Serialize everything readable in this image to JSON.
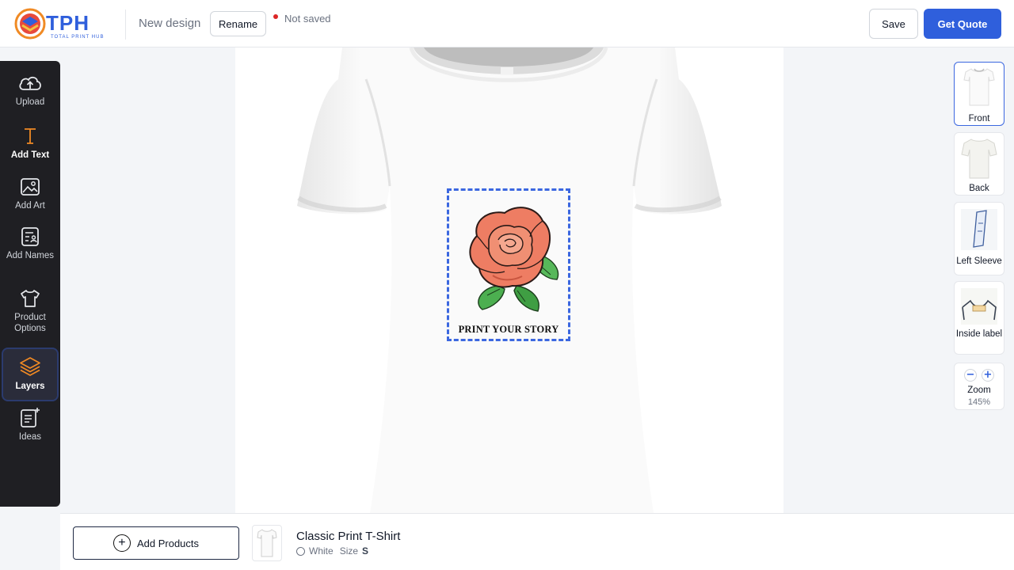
{
  "header": {
    "logo_text": "TPH",
    "logo_sub": "TOTAL PRINT HUB",
    "design_name": "New design",
    "rename_label": "Rename",
    "status_text": "Not saved",
    "save_label": "Save",
    "quote_label": "Get Quote"
  },
  "sidebar": {
    "items": [
      {
        "label": "Upload",
        "icon": "cloud-upload-icon"
      },
      {
        "label": "Add Text",
        "icon": "text-icon"
      },
      {
        "label": "Add Art",
        "icon": "image-icon"
      },
      {
        "label": "Add Names",
        "icon": "names-icon"
      },
      {
        "label": "Product Options",
        "icon": "tshirt-icon"
      },
      {
        "label": "Layers",
        "icon": "layers-icon"
      },
      {
        "label": "Ideas",
        "icon": "ideas-icon"
      }
    ],
    "active": "Layers"
  },
  "canvas": {
    "print_text": "PRINT YOUR STORY"
  },
  "views": {
    "items": [
      {
        "label": "Front"
      },
      {
        "label": "Back"
      },
      {
        "label": "Left Sleeve"
      },
      {
        "label": "Inside label"
      }
    ],
    "active": "Front",
    "zoom_label": "Zoom",
    "zoom_value": "145%"
  },
  "bottom": {
    "add_products_label": "Add Products",
    "product_name": "Classic Print T-Shirt",
    "color_name": "White",
    "size_label": "Size",
    "size_value": "S"
  },
  "colors": {
    "accent": "#2f5fdc",
    "sidebar_bg": "#1f1f23",
    "active_orange": "#f08a24",
    "status_dot": "#dc2626"
  }
}
